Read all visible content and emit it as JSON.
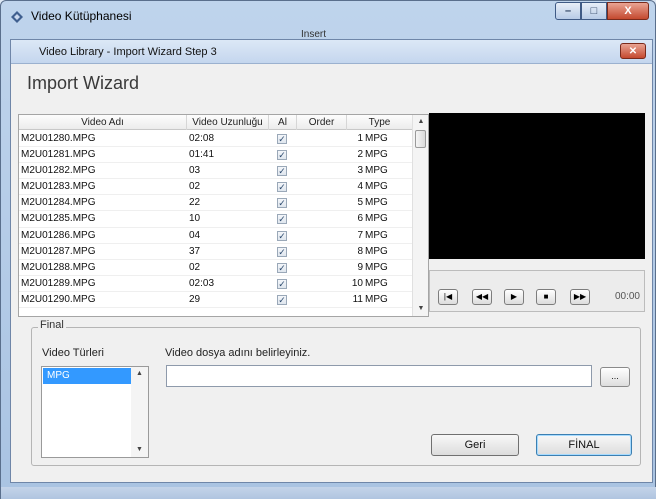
{
  "outer_window": {
    "title": "Video Kütüphanesi",
    "behind_text": "Insert"
  },
  "dialog": {
    "title": "Video Library - Import Wizard Step 3",
    "close_label": "✕"
  },
  "wizard": {
    "heading": "Import Wizard"
  },
  "grid": {
    "columns": [
      "Video Adı",
      "Video Uzunluğu",
      "Al",
      "Order",
      "Type"
    ],
    "rows": [
      {
        "name": "M2U01280.MPG",
        "duration": "02:08",
        "checked": true,
        "order": "1",
        "type": "MPG"
      },
      {
        "name": "M2U01281.MPG",
        "duration": "01:41",
        "checked": true,
        "order": "2",
        "type": "MPG"
      },
      {
        "name": "M2U01282.MPG",
        "duration": "03",
        "checked": true,
        "order": "3",
        "type": "MPG"
      },
      {
        "name": "M2U01283.MPG",
        "duration": "02",
        "checked": true,
        "order": "4",
        "type": "MPG"
      },
      {
        "name": "M2U01284.MPG",
        "duration": "22",
        "checked": true,
        "order": "5",
        "type": "MPG"
      },
      {
        "name": "M2U01285.MPG",
        "duration": "10",
        "checked": true,
        "order": "6",
        "type": "MPG"
      },
      {
        "name": "M2U01286.MPG",
        "duration": "04",
        "checked": true,
        "order": "7",
        "type": "MPG"
      },
      {
        "name": "M2U01287.MPG",
        "duration": "37",
        "checked": true,
        "order": "8",
        "type": "MPG"
      },
      {
        "name": "M2U01288.MPG",
        "duration": "02",
        "checked": true,
        "order": "9",
        "type": "MPG"
      },
      {
        "name": "M2U01289.MPG",
        "duration": "02:03",
        "checked": true,
        "order": "10",
        "type": "MPG"
      },
      {
        "name": "M2U01290.MPG",
        "duration": "29",
        "checked": true,
        "order": "11",
        "type": "MPG"
      }
    ]
  },
  "player": {
    "time": "00:00",
    "buttons": [
      "first",
      "rewind",
      "play",
      "stop",
      "forward"
    ]
  },
  "final_group": {
    "legend": "Final",
    "types_label": "Video Türleri",
    "types": [
      "MPG"
    ],
    "file_label": "Video dosya adını belirleyiniz.",
    "file_value": "",
    "browse_label": "...",
    "back_label": "Geri",
    "final_label": "FİNAL"
  },
  "colors": {
    "selection": "#3399ff",
    "video_bg": "#000000"
  }
}
